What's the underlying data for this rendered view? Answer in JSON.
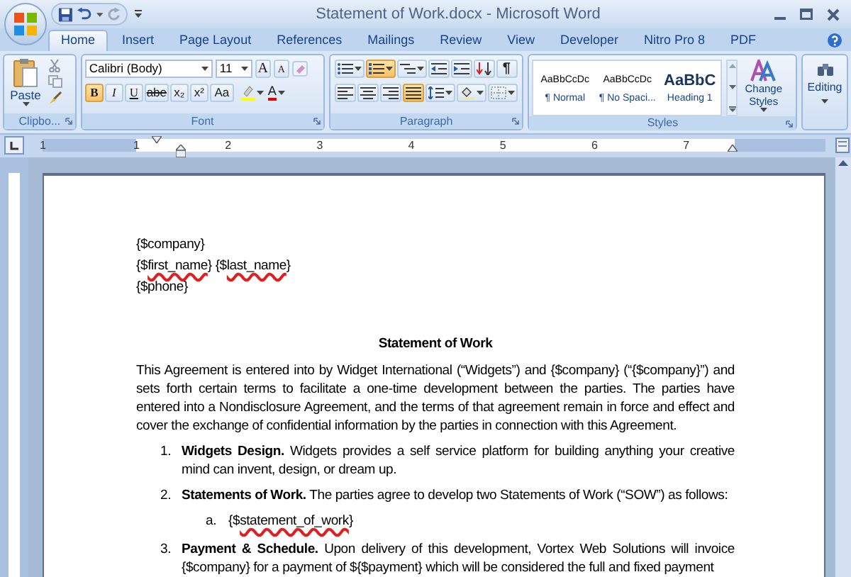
{
  "window": {
    "title": "Statement of Work.docx - Microsoft Word"
  },
  "tabs": [
    {
      "label": "Home",
      "selected": true
    },
    {
      "label": "Insert",
      "selected": false
    },
    {
      "label": "Page Layout",
      "selected": false
    },
    {
      "label": "References",
      "selected": false
    },
    {
      "label": "Mailings",
      "selected": false
    },
    {
      "label": "Review",
      "selected": false
    },
    {
      "label": "View",
      "selected": false
    },
    {
      "label": "Developer",
      "selected": false
    },
    {
      "label": "Nitro Pro 8",
      "selected": false
    },
    {
      "label": "PDF",
      "selected": false
    }
  ],
  "ribbon": {
    "clipboard": {
      "paste_label": "Paste",
      "group_label": "Clipbo..."
    },
    "font": {
      "font_name": "Calibri (Body)",
      "font_size": "11",
      "size_buttons": [
        {
          "label": "A"
        },
        {
          "label": "A"
        }
      ],
      "format_buttons": [
        {
          "kind": "bold",
          "label": "B",
          "on": true
        },
        {
          "kind": "italic",
          "label": "I",
          "on": false
        },
        {
          "kind": "underline",
          "label": "U",
          "on": false
        },
        {
          "kind": "strike",
          "label": "abe",
          "on": false
        },
        {
          "kind": "sub",
          "label": "x₂",
          "on": false
        },
        {
          "kind": "sup",
          "label": "x²",
          "on": false
        },
        {
          "kind": "case",
          "label": "Aa",
          "on": false
        }
      ],
      "color_button": {
        "label": "A"
      },
      "group_label": "Font"
    },
    "paragraph": {
      "row_1": [
        {
          "kind": "bullets",
          "on": false
        },
        {
          "kind": "numbering",
          "on": true
        },
        {
          "kind": "multilevel",
          "on": false
        },
        {
          "kind": "outdent",
          "on": false
        },
        {
          "kind": "indent",
          "on": false
        },
        {
          "kind": "sort",
          "on": false
        },
        {
          "kind": "pilcrow",
          "label": "¶",
          "on": false
        }
      ],
      "row_2": [
        {
          "kind": "align-left",
          "on": false
        },
        {
          "kind": "center",
          "on": false
        },
        {
          "kind": "align-right",
          "on": false
        },
        {
          "kind": "justify",
          "on": true
        },
        {
          "kind": "line-spacing",
          "on": false
        },
        {
          "kind": "shading",
          "on": false
        },
        {
          "kind": "borders",
          "on": false
        }
      ],
      "group_label": "Paragraph"
    },
    "styles": {
      "items": [
        {
          "preview": "AaBbCcDc",
          "name": "¶ Normal",
          "selected": false
        },
        {
          "preview": "AaBbCcDc",
          "name": "¶ No Spaci...",
          "selected": false
        },
        {
          "preview": "AaBbC",
          "name": "Heading 1",
          "selected": false
        }
      ],
      "change_styles_label": "Change Styles",
      "group_label": "Styles"
    },
    "editing": {
      "label": "Editing"
    }
  },
  "ruler": {
    "labels": [
      "1",
      "1",
      "2",
      "3",
      "4",
      "5",
      "6",
      "7"
    ]
  },
  "document": {
    "header_lines": [
      [
        {
          "text": "{$company}",
          "misspelled": false
        }
      ],
      [
        {
          "text": "{$",
          "misspelled": false
        },
        {
          "text": "first_name",
          "misspelled": true
        },
        {
          "text": "} {$",
          "misspelled": false
        },
        {
          "text": "last_name",
          "misspelled": true
        },
        {
          "text": "}",
          "misspelled": false
        }
      ],
      [
        {
          "text": "{$phone}",
          "misspelled": false
        }
      ]
    ],
    "title": "Statement of Work",
    "paragraph": "This Agreement is entered into by Widget International (“Widgets”) and {$company} (“{$company}”) and sets forth certain terms to facilitate a one-time development between the parties.  The parties have entered into a Nondisclosure Agreement, and the terms of that agreement remain in force and effect and cover the exchange of confidential information by the parties in connection with this Agreement.",
    "list": [
      {
        "number": "1.",
        "text": "**Widgets Design.**  Widgets provides a self service platform for building anything your creative mind can invent, design, or dream up."
      },
      {
        "number": "2.",
        "text": "**Statements of Work.**  The parties agree to develop two Statements of Work (“SOW”) as follows:",
        "children": [
          {
            "number": "a.",
            "segments": [
              {
                "text": "{$",
                "misspelled": false
              },
              {
                "text": "statement_of_work",
                "misspelled": true
              },
              {
                "text": "}",
                "misspelled": false
              }
            ]
          }
        ]
      },
      {
        "number": "3.",
        "text": "**Payment & Schedule.**  Upon delivery of this development, Vortex Web Solutions will invoice {$company} for a payment of ${$payment} which will be considered the full and fixed payment"
      }
    ]
  }
}
